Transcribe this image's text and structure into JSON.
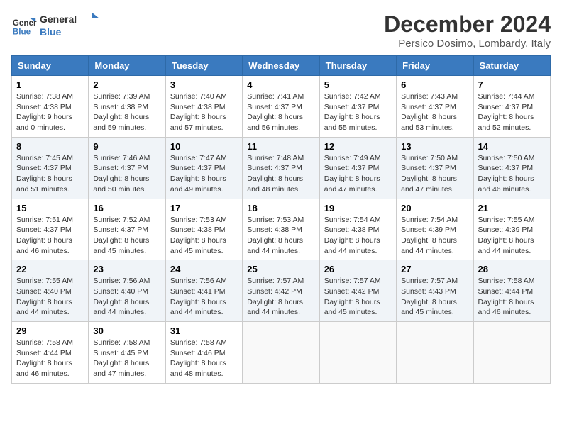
{
  "header": {
    "logo_line1": "General",
    "logo_line2": "Blue",
    "month": "December 2024",
    "location": "Persico Dosimo, Lombardy, Italy"
  },
  "weekdays": [
    "Sunday",
    "Monday",
    "Tuesday",
    "Wednesday",
    "Thursday",
    "Friday",
    "Saturday"
  ],
  "weeks": [
    [
      {
        "day": "1",
        "sunrise": "7:38 AM",
        "sunset": "4:38 PM",
        "daylight": "9 hours and 0 minutes."
      },
      {
        "day": "2",
        "sunrise": "7:39 AM",
        "sunset": "4:38 PM",
        "daylight": "8 hours and 59 minutes."
      },
      {
        "day": "3",
        "sunrise": "7:40 AM",
        "sunset": "4:38 PM",
        "daylight": "8 hours and 57 minutes."
      },
      {
        "day": "4",
        "sunrise": "7:41 AM",
        "sunset": "4:37 PM",
        "daylight": "8 hours and 56 minutes."
      },
      {
        "day": "5",
        "sunrise": "7:42 AM",
        "sunset": "4:37 PM",
        "daylight": "8 hours and 55 minutes."
      },
      {
        "day": "6",
        "sunrise": "7:43 AM",
        "sunset": "4:37 PM",
        "daylight": "8 hours and 53 minutes."
      },
      {
        "day": "7",
        "sunrise": "7:44 AM",
        "sunset": "4:37 PM",
        "daylight": "8 hours and 52 minutes."
      }
    ],
    [
      {
        "day": "8",
        "sunrise": "7:45 AM",
        "sunset": "4:37 PM",
        "daylight": "8 hours and 51 minutes."
      },
      {
        "day": "9",
        "sunrise": "7:46 AM",
        "sunset": "4:37 PM",
        "daylight": "8 hours and 50 minutes."
      },
      {
        "day": "10",
        "sunrise": "7:47 AM",
        "sunset": "4:37 PM",
        "daylight": "8 hours and 49 minutes."
      },
      {
        "day": "11",
        "sunrise": "7:48 AM",
        "sunset": "4:37 PM",
        "daylight": "8 hours and 48 minutes."
      },
      {
        "day": "12",
        "sunrise": "7:49 AM",
        "sunset": "4:37 PM",
        "daylight": "8 hours and 47 minutes."
      },
      {
        "day": "13",
        "sunrise": "7:50 AM",
        "sunset": "4:37 PM",
        "daylight": "8 hours and 47 minutes."
      },
      {
        "day": "14",
        "sunrise": "7:50 AM",
        "sunset": "4:37 PM",
        "daylight": "8 hours and 46 minutes."
      }
    ],
    [
      {
        "day": "15",
        "sunrise": "7:51 AM",
        "sunset": "4:37 PM",
        "daylight": "8 hours and 46 minutes."
      },
      {
        "day": "16",
        "sunrise": "7:52 AM",
        "sunset": "4:37 PM",
        "daylight": "8 hours and 45 minutes."
      },
      {
        "day": "17",
        "sunrise": "7:53 AM",
        "sunset": "4:38 PM",
        "daylight": "8 hours and 45 minutes."
      },
      {
        "day": "18",
        "sunrise": "7:53 AM",
        "sunset": "4:38 PM",
        "daylight": "8 hours and 44 minutes."
      },
      {
        "day": "19",
        "sunrise": "7:54 AM",
        "sunset": "4:38 PM",
        "daylight": "8 hours and 44 minutes."
      },
      {
        "day": "20",
        "sunrise": "7:54 AM",
        "sunset": "4:39 PM",
        "daylight": "8 hours and 44 minutes."
      },
      {
        "day": "21",
        "sunrise": "7:55 AM",
        "sunset": "4:39 PM",
        "daylight": "8 hours and 44 minutes."
      }
    ],
    [
      {
        "day": "22",
        "sunrise": "7:55 AM",
        "sunset": "4:40 PM",
        "daylight": "8 hours and 44 minutes."
      },
      {
        "day": "23",
        "sunrise": "7:56 AM",
        "sunset": "4:40 PM",
        "daylight": "8 hours and 44 minutes."
      },
      {
        "day": "24",
        "sunrise": "7:56 AM",
        "sunset": "4:41 PM",
        "daylight": "8 hours and 44 minutes."
      },
      {
        "day": "25",
        "sunrise": "7:57 AM",
        "sunset": "4:42 PM",
        "daylight": "8 hours and 44 minutes."
      },
      {
        "day": "26",
        "sunrise": "7:57 AM",
        "sunset": "4:42 PM",
        "daylight": "8 hours and 45 minutes."
      },
      {
        "day": "27",
        "sunrise": "7:57 AM",
        "sunset": "4:43 PM",
        "daylight": "8 hours and 45 minutes."
      },
      {
        "day": "28",
        "sunrise": "7:58 AM",
        "sunset": "4:44 PM",
        "daylight": "8 hours and 46 minutes."
      }
    ],
    [
      {
        "day": "29",
        "sunrise": "7:58 AM",
        "sunset": "4:44 PM",
        "daylight": "8 hours and 46 minutes."
      },
      {
        "day": "30",
        "sunrise": "7:58 AM",
        "sunset": "4:45 PM",
        "daylight": "8 hours and 47 minutes."
      },
      {
        "day": "31",
        "sunrise": "7:58 AM",
        "sunset": "4:46 PM",
        "daylight": "8 hours and 48 minutes."
      },
      null,
      null,
      null,
      null
    ]
  ]
}
